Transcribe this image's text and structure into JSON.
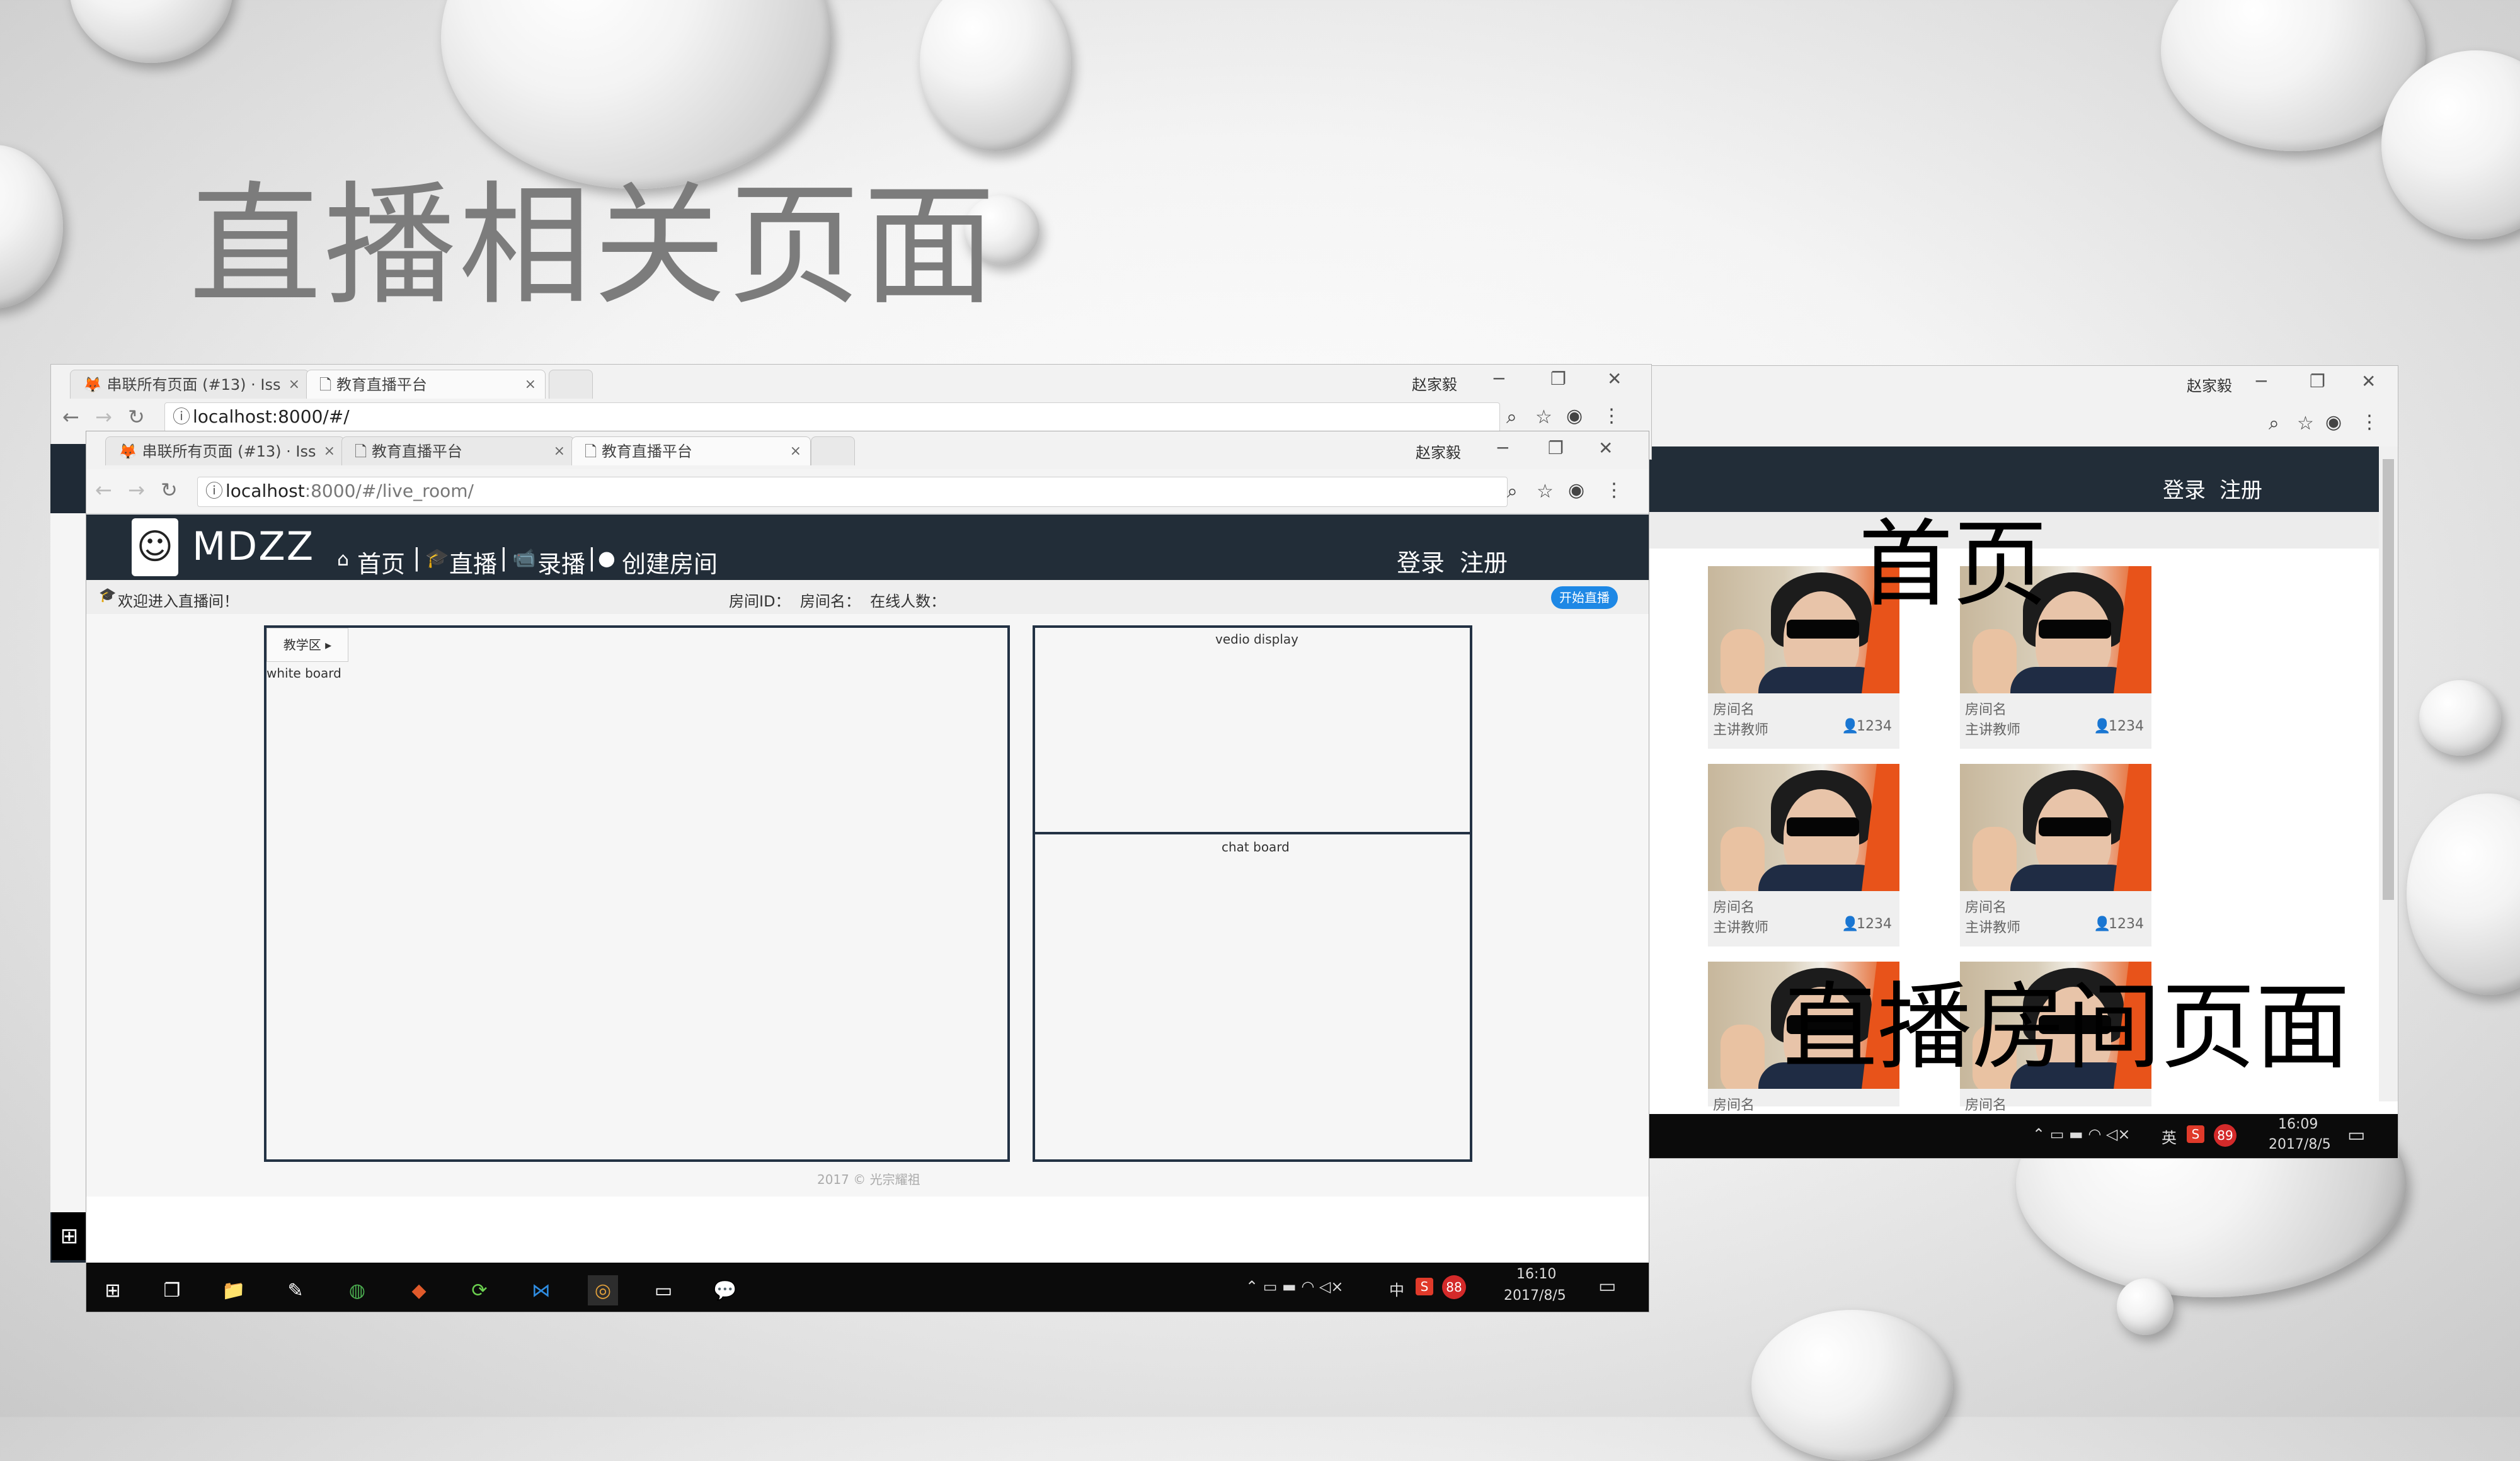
{
  "slide": {
    "title": "直播相关页面"
  },
  "home_window": {
    "user_badge": "赵家毅",
    "buttons": {
      "minimize": "─",
      "restore": "❐",
      "close": "✕"
    },
    "nav_links": {
      "login": "登录",
      "register": "注册"
    },
    "cards": [
      {
        "room": "房间名",
        "teacher": "主讲教师",
        "count": "1234"
      },
      {
        "room": "房间名",
        "teacher": "主讲教师",
        "count": "1234"
      },
      {
        "room": "房间名",
        "teacher": "主讲教师",
        "count": "1234"
      },
      {
        "room": "房间名",
        "teacher": "主讲教师",
        "count": "1234"
      },
      {
        "room": "房间名"
      },
      {
        "room": "房间名"
      }
    ],
    "taskbar": {
      "time": "16:09",
      "date": "2017/8/5",
      "ime": "英",
      "badge": "89"
    }
  },
  "overlays": {
    "home_label": "首页",
    "live_label": "直播房间页面"
  },
  "back_browser": {
    "tabs": [
      {
        "label": "串联所有页面 (#13) · Iss"
      },
      {
        "label": "教育直播平台"
      }
    ],
    "url": "localhost:8000/#/",
    "user_badge": "赵家毅"
  },
  "front_browser": {
    "tabs": [
      {
        "label": "串联所有页面 (#13) · Iss"
      },
      {
        "label": "教育直播平台"
      },
      {
        "label": "教育直播平台"
      }
    ],
    "url_host": "localhost",
    "url_rest": ":8000/#/live_room/",
    "user_badge": "赵家毅"
  },
  "app": {
    "logo": "MDZZ",
    "nav": {
      "home": "首页",
      "live": "直播",
      "record": "录播",
      "create": "创建房间",
      "sep": "|"
    },
    "login": "登录",
    "register": "注册",
    "welcome": "欢迎进入直播间！",
    "room_info": "房间ID：  房间名：  在线人数：",
    "start_button": "开始直播",
    "teaching_tab": "教学区",
    "whiteboard": "white board",
    "video_display": "vedio display",
    "chat_board": "chat board",
    "footer": "2017 © 光宗耀祖"
  },
  "taskbar": {
    "time": "16:10",
    "date": "2017/8/5",
    "ime": "中",
    "badge": "88"
  }
}
